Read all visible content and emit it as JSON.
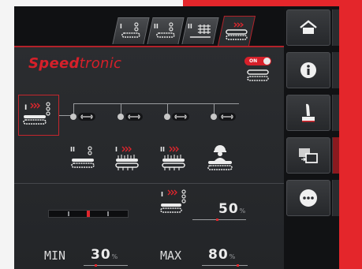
{
  "brand": {
    "name_part1": "Speed",
    "name_part2": "tronic"
  },
  "tabs": [
    {
      "roman": "I",
      "active": false,
      "icon": "conveyor-chain-icon"
    },
    {
      "roman": "II",
      "active": false,
      "icon": "conveyor-chain-icon"
    },
    {
      "roman": "II",
      "active": false,
      "icon": "grid-conveyor-icon"
    },
    {
      "roman": "",
      "active": true,
      "icon": "speedtronic-conveyor-icon"
    }
  ],
  "toggle": {
    "label": "ON",
    "state": true
  },
  "units": [
    {
      "roman": "II",
      "icon": "chain-conveyor-icon"
    },
    {
      "roman": "I",
      "icon": "brush-conveyor-icon"
    },
    {
      "roman": "II",
      "icon": "brush-conveyor-icon"
    },
    {
      "roman": "",
      "icon": "operator-conveyor-icon"
    }
  ],
  "selected_unit": {
    "roman": "I",
    "icon": "speed-conveyor-icon"
  },
  "speed": {
    "value": "50",
    "unit": "%",
    "level_fraction": 0.5
  },
  "min": {
    "label": "MIN",
    "value": "30",
    "unit": "%"
  },
  "max": {
    "label": "MAX",
    "value": "80",
    "unit": "%"
  },
  "side_menu": [
    {
      "name": "home-icon",
      "highlight": false
    },
    {
      "name": "info-icon",
      "highlight": false
    },
    {
      "name": "joystick-icon",
      "highlight": false
    },
    {
      "name": "screen-switch-icon",
      "highlight": true
    },
    {
      "name": "more-icon",
      "highlight": false
    }
  ],
  "colors": {
    "accent": "#d6202a",
    "background": "#1a1c1e",
    "text": "#ececec"
  }
}
